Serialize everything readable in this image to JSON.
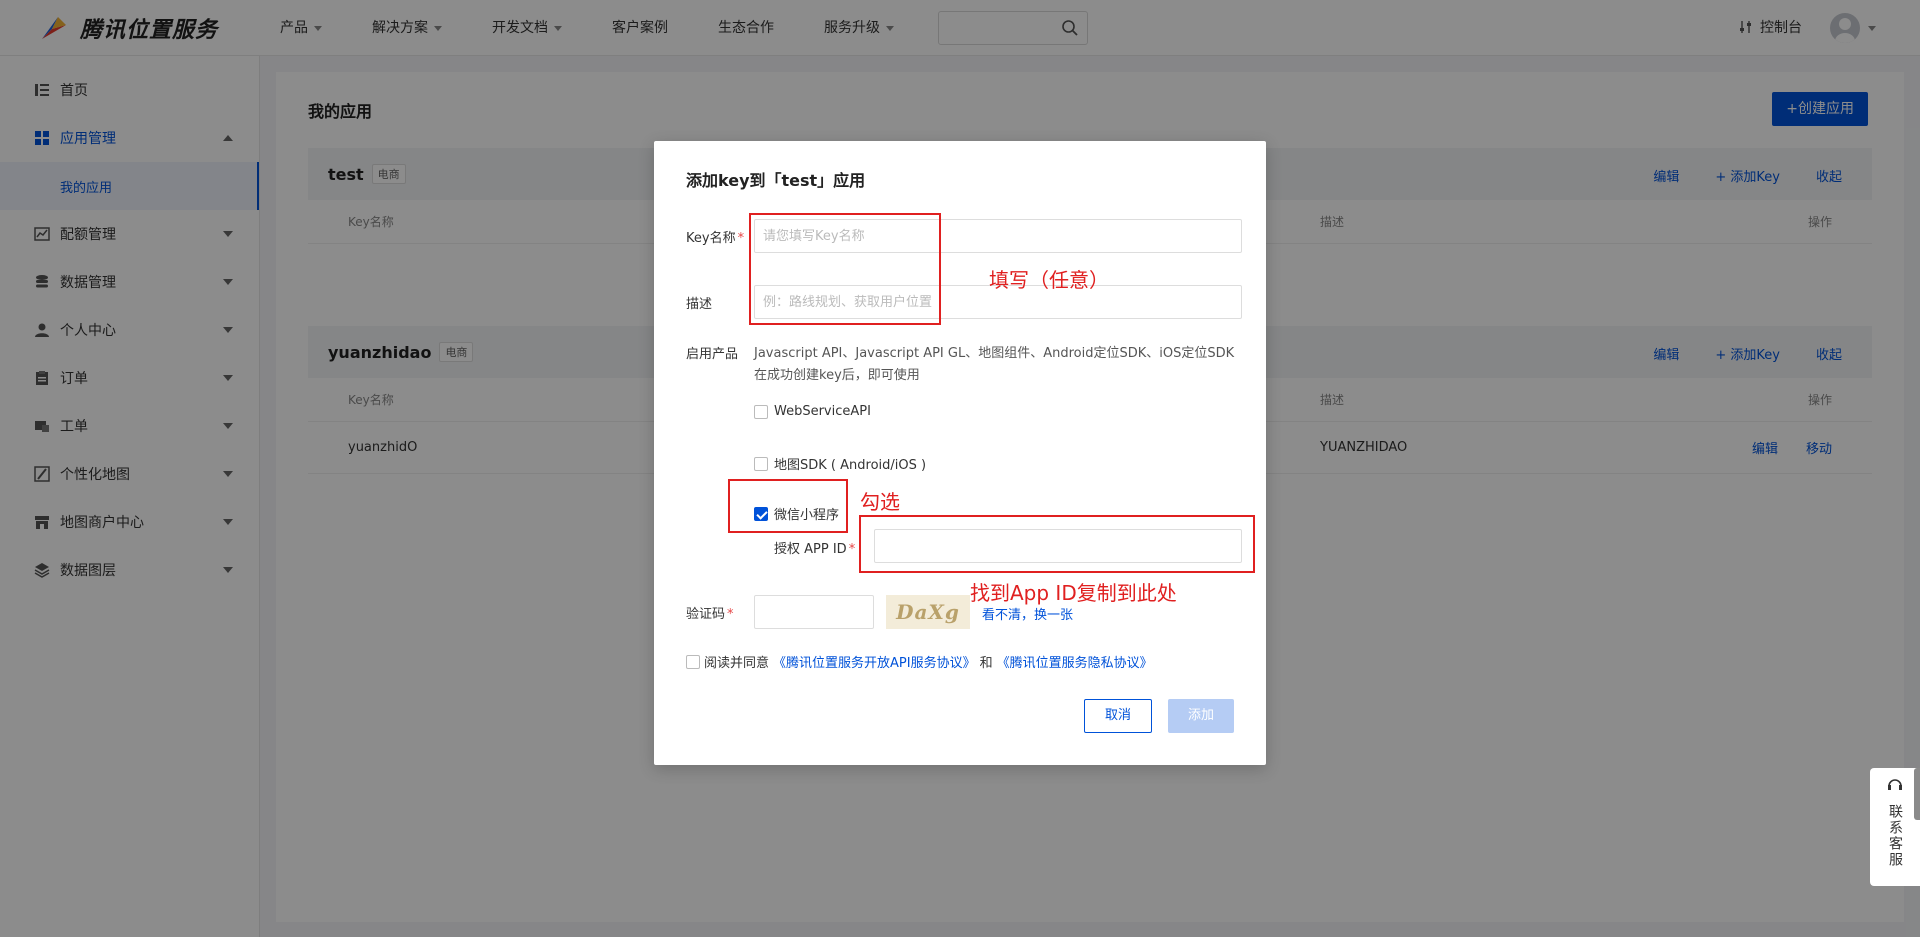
{
  "brand": {
    "name": "腾讯位置服务"
  },
  "nav": {
    "items": [
      {
        "label": "产品",
        "caret": true
      },
      {
        "label": "解决方案",
        "caret": true
      },
      {
        "label": "开发文档",
        "caret": true
      },
      {
        "label": "客户案例",
        "caret": false
      },
      {
        "label": "生态合作",
        "caret": false
      },
      {
        "label": "服务升级",
        "caret": true
      }
    ],
    "console_label": "控制台"
  },
  "sidebar": {
    "items": [
      {
        "label": "首页",
        "icon": "list-icon"
      },
      {
        "label": "应用管理",
        "icon": "grid-icon"
      },
      {
        "label": "我的应用"
      },
      {
        "label": "配额管理",
        "icon": "chart-icon"
      },
      {
        "label": "数据管理",
        "icon": "database-icon"
      },
      {
        "label": "个人中心",
        "icon": "user-icon"
      },
      {
        "label": "订单",
        "icon": "clipboard-icon"
      },
      {
        "label": "工单",
        "icon": "ticket-icon"
      },
      {
        "label": "个性化地图",
        "icon": "map-style-icon"
      },
      {
        "label": "地图商户中心",
        "icon": "store-icon"
      },
      {
        "label": "数据图层",
        "icon": "layers-icon"
      }
    ]
  },
  "main": {
    "title": "我的应用",
    "create_button": "+创建应用",
    "apps": [
      {
        "name": "test",
        "tag": "电商",
        "actions": [
          "编辑",
          "+ 添加Key",
          "收起"
        ],
        "columns": [
          "Key名称",
          "描述",
          "操作"
        ],
        "rows": []
      },
      {
        "name": "yuanzhidao",
        "tag": "电商",
        "actions": [
          "编辑",
          "+ 添加Key",
          "收起"
        ],
        "columns": [
          "Key名称",
          "描述",
          "操作"
        ],
        "rows": [
          {
            "key_name": "yuanzhidO",
            "desc": "YUANZHIDAO",
            "op_edit": "编辑",
            "op_move": "移动"
          }
        ]
      }
    ]
  },
  "modal": {
    "title": "添加key到「test」应用",
    "key_name_label": "Key名称",
    "key_name_placeholder": "请您填写Key名称",
    "desc_label": "描述",
    "desc_placeholder": "例：路线规划、获取用户位置",
    "products_label": "启用产品",
    "products_text": "Javascript API、Javascript API GL、地图组件、Android定位SDK、iOS定位SDK在成功创建key后，即可使用",
    "options": [
      {
        "label": "WebServiceAPI",
        "checked": false
      },
      {
        "label": "地图SDK ( Android/iOS )",
        "checked": false
      },
      {
        "label": "微信小程序",
        "checked": true
      }
    ],
    "appid_label": "授权 APP ID",
    "appid_value": "",
    "captcha_label": "验证码",
    "captcha_value": "",
    "captcha_image_text": "DaXg",
    "captcha_refresh": "看不清，换一张",
    "agree_prefix": "阅读并同意",
    "agree_link1": "《腾讯位置服务开放API服务协议》",
    "agree_and": "和",
    "agree_link2": "《腾讯位置服务隐私协议》",
    "cancel_label": "取消",
    "add_label": "添加"
  },
  "annotations": {
    "fill_note": "填写（任意）",
    "check_note": "勾选",
    "appid_note": "找到App ID复制到此处"
  },
  "service_widget": {
    "label": "联系客服"
  },
  "colors": {
    "primary": "#0052d9",
    "annotation": "#e02020",
    "overlay": "rgba(0,0,0,0.45)"
  }
}
